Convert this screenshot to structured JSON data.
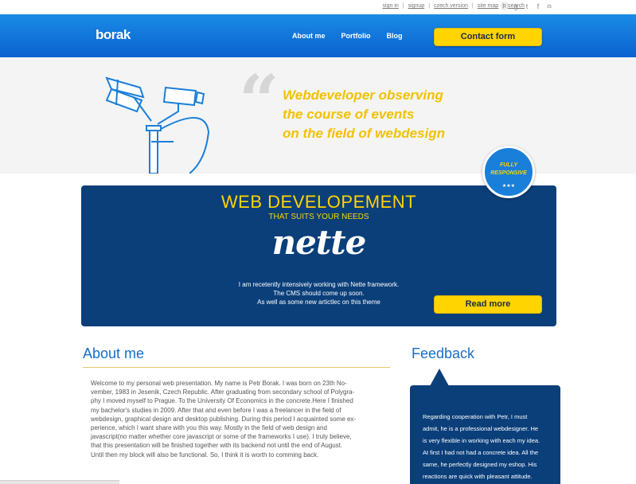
{
  "topbar": {
    "links": [
      "sign in",
      "signup",
      "czech version",
      "site map",
      "search"
    ],
    "social_icons": [
      "skype-icon",
      "google-plus-icon",
      "tumblr-icon",
      "facebook-icon",
      "rss-icon"
    ]
  },
  "header": {
    "logo": "borak",
    "nav": [
      "About me",
      "Portfolio",
      "Blog"
    ],
    "contact_button": "Contact form"
  },
  "hero": {
    "quote_mark": "“",
    "tagline_lines": [
      "Webdeveloper observing",
      "the course of events",
      "on the field of webdesign"
    ]
  },
  "badge": {
    "line1": "FULLY",
    "line2": "RESPONSIVE",
    "stars": "★★★"
  },
  "banner": {
    "title": "WEB DEVELOPEMENT",
    "subtitle": "THAT SUITS YOUR NEEDS",
    "logo_text": "nette",
    "text_lines": [
      "I am recetently intensively working with Nette framework.",
      "The CMS should come up soon.",
      "As well as some new artictlec on this theme"
    ],
    "read_more": "Read more"
  },
  "about": {
    "title": "About me",
    "text_lines": [
      "Welcome to my personal web presentation. My name is Petr Borak. I was born on 23th No-",
      "vember, 1983 in Jesenik, Czech Republic. After graduating from secondary school of Polygra-",
      "phy I moved myself to Prague. To the University Of Economics in the concrete.Here I finished",
      "my bachelor's studies in 2009. After that and even before I was a freelancer in the field of",
      "webdesign, graphical design and desktop publishing. During this period I acquainted some ex-",
      "perience, which I want share with you this way. Mostly in the field of web design and",
      "javascript(no matter whether core javascript or some of the frameworks I use). I truly believe,",
      "that this presentation will be finished together with its backend not until the end of August.",
      "Until then my block will also be functional. So, I think it is worth to comming back."
    ]
  },
  "feedback": {
    "title": "Feedback",
    "text_lines": [
      "Regarding cooperation with Petr, I must",
      "admit, he is a professional webdesigner. He",
      "is very flexible in working with each my idea.",
      "At first I had not had a concrete idea. All the",
      "same, he perfectly designed my eshop. His",
      "reactions are quick with pleasant attitude."
    ]
  },
  "colors": {
    "header_blue": "#0a62cf",
    "banner_navy": "#0b3f7a",
    "accent_yellow": "#ffd400",
    "heading_blue": "#1a6cc7"
  }
}
